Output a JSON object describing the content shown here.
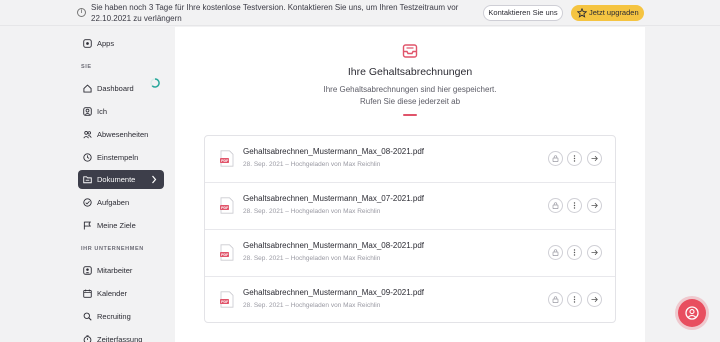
{
  "banner": {
    "message": "Sie haben noch 3 Tage für Ihre kostenlose Testversion. Kontaktieren Sie uns, um Ihren Testzeitraum vor 22.10.2021 zu verlängern",
    "contact_label": "Kontaktieren Sie uns",
    "upgrade_label": "Jetzt upgraden"
  },
  "sidebar": {
    "top_items": [
      {
        "label": "Apps",
        "icon": "apps-icon"
      }
    ],
    "section_sie": "SIE",
    "sie_items": [
      {
        "label": "Dashboard",
        "icon": "home-icon"
      },
      {
        "label": "Ich",
        "icon": "user-icon"
      },
      {
        "label": "Abwesenheiten",
        "icon": "people-icon"
      },
      {
        "label": "Einstempeln",
        "icon": "clock-icon"
      },
      {
        "label": "Dokumente",
        "icon": "folder-icon",
        "active": true
      },
      {
        "label": "Aufgaben",
        "icon": "check-circle-icon"
      },
      {
        "label": "Meine Ziele",
        "icon": "flag-icon"
      }
    ],
    "section_company": "IHR UNTERNEHMEN",
    "company_items": [
      {
        "label": "Mitarbeiter",
        "icon": "team-icon"
      },
      {
        "label": "Kalender",
        "icon": "calendar-icon"
      },
      {
        "label": "Recruiting",
        "icon": "search-icon"
      },
      {
        "label": "Zeiterfassung",
        "icon": "timer-icon"
      }
    ]
  },
  "main": {
    "title": "Ihre Gehaltsabrechnungen",
    "subtitle_line1": "Ihre Gehaltsabrechnungen sind hier gespeichert.",
    "subtitle_line2": "Rufen Sie diese jederzeit ab",
    "documents": [
      {
        "filename": "Gehaltsabrechnen_Mustermann_Max_08-2021.pdf",
        "meta": "28. Sep. 2021 – Hochgeladen von Max Reichlin"
      },
      {
        "filename": "Gehaltsabrechnen_Mustermann_Max_07-2021.pdf",
        "meta": "28. Sep. 2021 – Hochgeladen von Max Reichlin"
      },
      {
        "filename": "Gehaltsabrechnen_Mustermann_Max_08-2021.pdf",
        "meta": "28. Sep. 2021 – Hochgeladen von Max Reichlin"
      },
      {
        "filename": "Gehaltsabrechnen_Mustermann_Max_09-2021.pdf",
        "meta": "28. Sep. 2021 – Hochgeladen von Max Reichlin"
      }
    ]
  },
  "colors": {
    "accent": "#e84e5f",
    "upgrade": "#f5c441",
    "active_nav": "#3d3e4a"
  }
}
